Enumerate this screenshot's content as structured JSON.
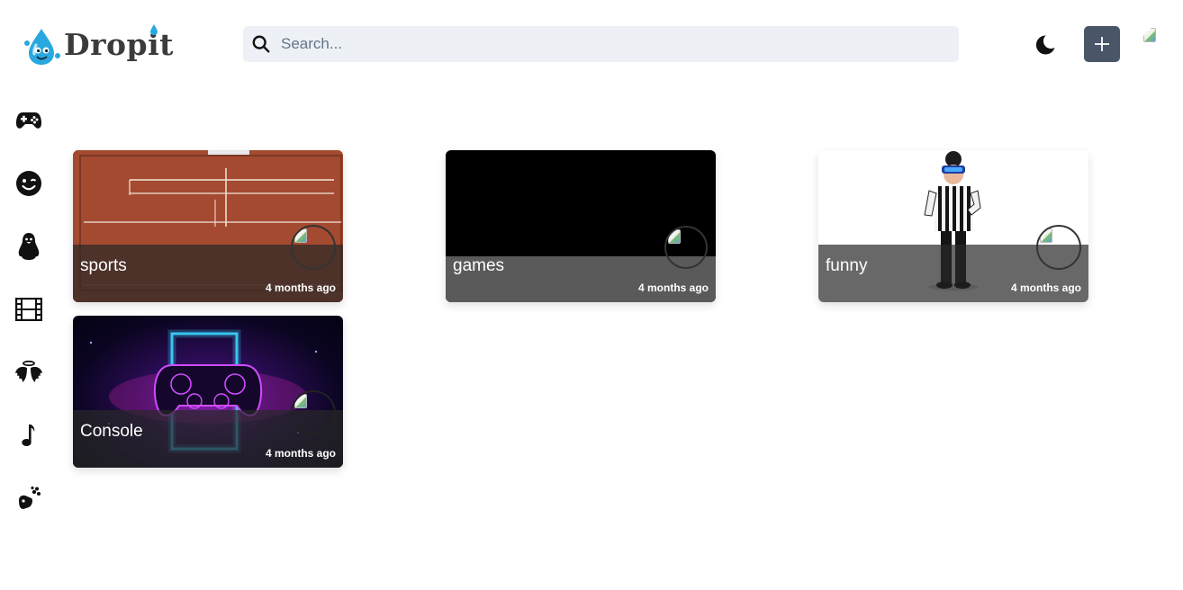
{
  "header": {
    "logo_text": "Dropit",
    "search_placeholder": "Search..."
  },
  "sidebar": {
    "items": [
      {
        "icon": "gamepad-icon"
      },
      {
        "icon": "wink-face-icon"
      },
      {
        "icon": "penguin-icon"
      },
      {
        "icon": "film-icon"
      },
      {
        "icon": "wings-icon"
      },
      {
        "icon": "music-note-icon"
      },
      {
        "icon": "dog-paw-icon"
      }
    ]
  },
  "pins": [
    {
      "title": "sports",
      "time": "4 months ago",
      "image": "tennis-court-aerial"
    },
    {
      "title": "games",
      "time": "4 months ago",
      "image": "black"
    },
    {
      "title": "funny",
      "time": "4 months ago",
      "image": "referee-vr-character"
    },
    {
      "title": "Console",
      "time": "4 months ago",
      "image": "neon-gamepad"
    }
  ],
  "colors": {
    "add_button": "#4a5568",
    "search_bg": "#edf1f5",
    "overlay": "rgba(40,40,40,0.7)"
  }
}
